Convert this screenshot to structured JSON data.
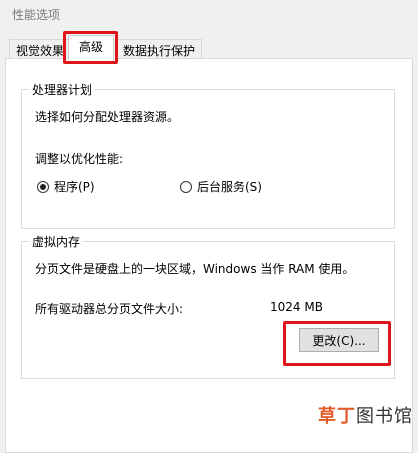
{
  "window": {
    "title": "性能选项"
  },
  "tabs": [
    {
      "label": "视觉效果"
    },
    {
      "label": "高级"
    },
    {
      "label": "数据执行保护"
    }
  ],
  "processor": {
    "title": "处理器计划",
    "description": "选择如何分配处理器资源。",
    "adjust_label": "调整以优化性能:",
    "options": [
      {
        "label": "程序(P)",
        "checked": true
      },
      {
        "label": "后台服务(S)",
        "checked": false
      }
    ]
  },
  "virtual_memory": {
    "title": "虚拟内存",
    "description": "分页文件是硬盘上的一块区域，Windows 当作 RAM 使用。",
    "total_label": "所有驱动器总分页文件大小:",
    "total_value": "1024 MB",
    "change_button": "更改(C)..."
  },
  "watermark": {
    "part1": "草丁",
    "part2": "图书馆"
  },
  "colors": {
    "highlight": "#e0141b"
  }
}
